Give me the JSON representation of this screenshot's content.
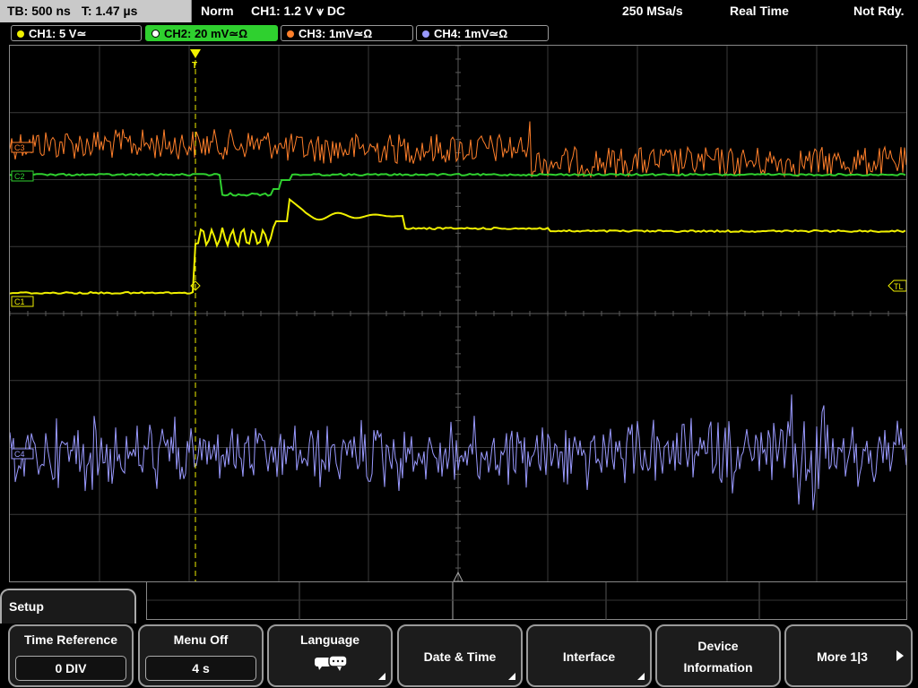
{
  "status": {
    "timebase": "TB: 500 ns",
    "trigger_time": "T: 1.47 µs",
    "mode": "Norm",
    "trigger_info": "CH1: 1.2 V ⩛ DC",
    "sample_rate": "250 MSa/s",
    "acq_mode": "Real Time",
    "state": "Not Rdy."
  },
  "channels": [
    {
      "label": "CH1: 5 V≃",
      "color": "#f0f000"
    },
    {
      "label": "CH2: 20 mV≃Ω",
      "color": "#2fd02f"
    },
    {
      "label": "CH3: 1mV≃Ω",
      "color": "#ff7f2a"
    },
    {
      "label": "CH4: 1mV≃Ω",
      "color": "#9a9aff"
    }
  ],
  "markers": {
    "c3": "C3",
    "c2": "C2",
    "c1": "C1",
    "c4": "C4",
    "trigger_level": "TL",
    "trigger_pos": "T"
  },
  "setup_label": "Setup",
  "menu": {
    "time_reference": {
      "label": "Time Reference",
      "value": "0 DIV"
    },
    "menu_off": {
      "label": "Menu Off",
      "value": "4 s"
    },
    "language": {
      "label": "Language"
    },
    "date_time": {
      "label": "Date & Time"
    },
    "interface": {
      "label": "Interface"
    },
    "device_info": {
      "line1": "Device",
      "line2": "Information"
    },
    "more": {
      "label": "More 1|3"
    }
  }
}
